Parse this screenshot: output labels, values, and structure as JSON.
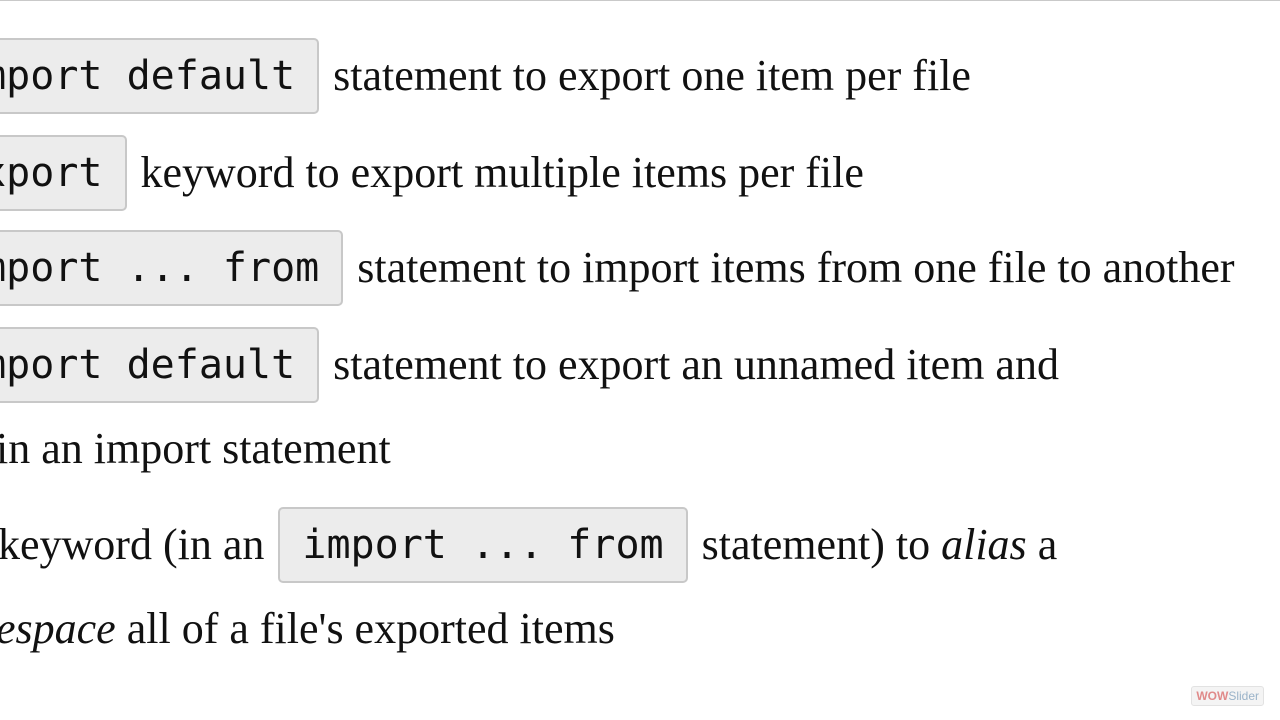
{
  "lines": [
    {
      "code": "import default",
      "text": "statement to export one item per file"
    },
    {
      "code": "export",
      "text": "keyword to export multiple items per file"
    },
    {
      "code": "import ... from",
      "text": "statement to import items from one file to another"
    },
    {
      "code": "import default",
      "text": "statement to export an unnamed item and"
    },
    {
      "text": "in an import statement"
    },
    {
      "text_before": "keyword (in an",
      "code": "import ... from",
      "text_after": "statement) to ",
      "em": "alias",
      "text_end": " a"
    },
    {
      "em": "espace",
      "text": " all of a file's exported items"
    }
  ],
  "watermark": {
    "part1": "WOW",
    "part2": "Slider"
  }
}
